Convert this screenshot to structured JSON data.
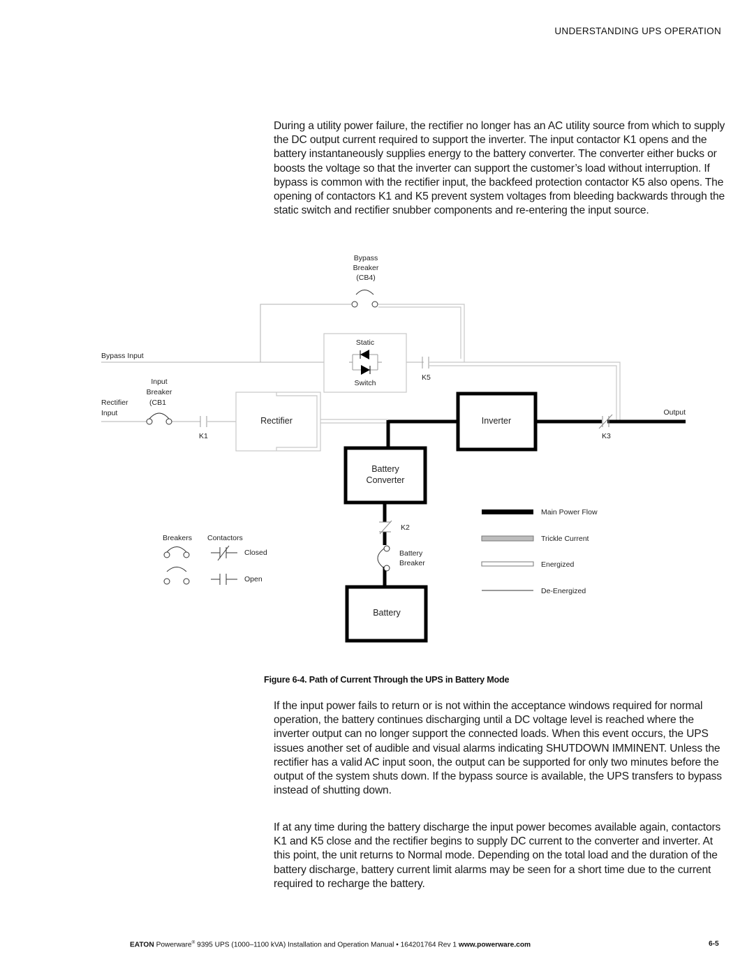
{
  "header": {
    "section_title": "UNDERSTANDING UPS OPERATION"
  },
  "body": {
    "paragraph_1": "During a utility power failure, the rectifier no longer has an AC utility source from which to supply the DC output current required to support the inverter. The input contactor K1 opens and the battery instantaneously supplies energy to the battery converter. The converter either bucks or boosts the voltage so that the inverter can support the customer’s load without interruption. If bypass is common with the rectifier input, the backfeed protection contactor K5 also opens. The opening of contactors K1 and K5 prevent system voltages from bleeding backwards through the static switch and rectifier snubber components and re-entering the input source.",
    "paragraph_2": "If the input power fails to return or is not within the acceptance windows required for normal operation, the battery continues discharging until a DC voltage level is reached where the inverter output can no longer support the connected loads. When this event occurs, the UPS issues another set of audible and visual alarms indicating SHUTDOWN IMMINENT. Unless the rectifier has a valid AC input soon, the output can be supported for only two minutes before the output of the system shuts down. If the bypass source is available, the UPS transfers to bypass instead of shutting down.",
    "paragraph_3": "If at any time during the battery discharge the input power becomes available again, contactors K1 and K5 close and the rectifier begins to supply DC current to the converter and inverter. At this point, the unit returns to Normal mode. Depending on the total load and the duration of the battery discharge, battery current limit alarms may be seen for a short time due to the current required to recharge the battery."
  },
  "figure": {
    "caption": "Figure 6-4. Path of Current Through the UPS in Battery Mode",
    "labels": {
      "bypass_breaker": [
        "Bypass",
        "Breaker",
        "(CB4)"
      ],
      "bypass_input": "Bypass Input",
      "static_switch_top": "Static",
      "static_switch_bottom": "Switch",
      "k5": "K5",
      "input_breaker": [
        "Input",
        "Breaker",
        "(CB1"
      ],
      "rectifier_input": [
        "Rectifier",
        "Input"
      ],
      "k1": "K1",
      "rectifier": "Rectifier",
      "inverter": "Inverter",
      "output": "Output",
      "k3": "K3",
      "battery_converter": [
        "Battery",
        "Converter"
      ],
      "k2": "K2",
      "battery_breaker": [
        "Battery",
        "Breaker"
      ],
      "battery": "Battery"
    },
    "symbol_key": {
      "breakers": "Breakers",
      "contactors": "Contactors",
      "closed": "Closed",
      "open": "Open"
    },
    "line_legend": [
      {
        "label": "Main Power Flow",
        "style": "main",
        "color": "#000000"
      },
      {
        "label": "Trickle Current",
        "style": "trickle",
        "color": "#bdbdbd"
      },
      {
        "label": "Energized",
        "style": "energized",
        "color": "#ffffff"
      },
      {
        "label": "De-Energized",
        "style": "deenergized",
        "color": "#333333"
      }
    ]
  },
  "footer": {
    "brand": "EATON",
    "product": "Powerware",
    "registered": "®",
    "description": " 9395 UPS (1000–1100 kVA) Installation and Operation Manual  •  164201764 Rev 1 ",
    "website": "www.powerware.com",
    "page_number": "6-5"
  }
}
